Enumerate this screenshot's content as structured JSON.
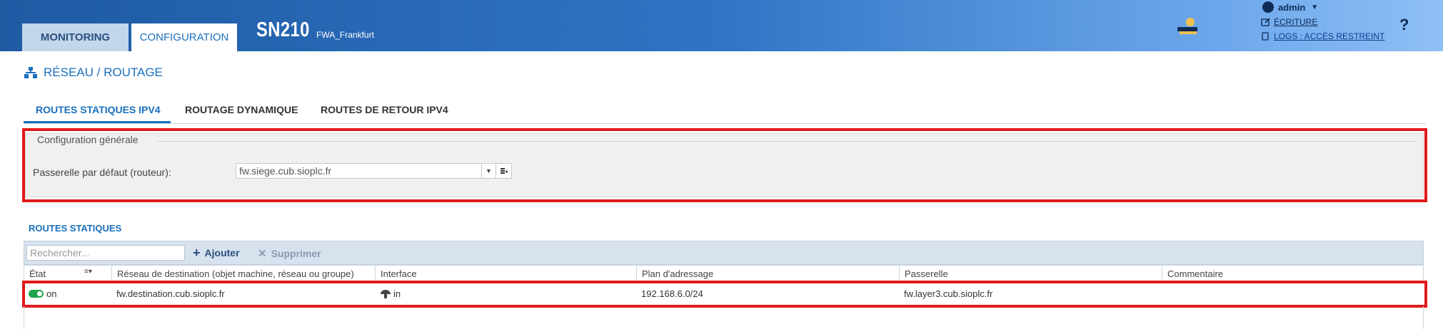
{
  "header": {
    "tabs": [
      {
        "label": "MONITORING"
      },
      {
        "label": "CONFIGURATION"
      }
    ],
    "device_model": "SN210",
    "device_name": "FWA_Frankfurt",
    "user": "admin",
    "write_mode": "ÉCRITURE",
    "logs_access": "LOGS : ACCÈS RESTREINT",
    "help": "?"
  },
  "page": {
    "title": "RÉSEAU / ROUTAGE",
    "subtabs": [
      {
        "label": "ROUTES STATIQUES IPV4"
      },
      {
        "label": "ROUTAGE DYNAMIQUE"
      },
      {
        "label": "ROUTES DE RETOUR IPV4"
      }
    ]
  },
  "general_config": {
    "legend": "Configuration générale",
    "gateway_label": "Passerelle par défaut (routeur):",
    "gateway_value": "fw.siege.cub.sioplc.fr"
  },
  "static_routes": {
    "title": "ROUTES STATIQUES",
    "search_placeholder": "Rechercher...",
    "add_label": "Ajouter",
    "delete_label": "Supprimer",
    "columns": [
      "État",
      "Réseau de destination (objet machine, réseau ou groupe)",
      "Interface",
      "Plan d'adressage",
      "Passerelle",
      "Commentaire"
    ],
    "rows": [
      {
        "state": "on",
        "destination": "fw.destination.cub.sioplc.fr",
        "interface": "in",
        "addressing": "192.168.6.0/24",
        "gateway": "fw.layer3.cub.sioplc.fr",
        "comment": ""
      }
    ]
  },
  "colors": {
    "accent": "#1a6fbd",
    "highlight_border": "#e11a1a",
    "toggle_on": "#1fa34a"
  }
}
